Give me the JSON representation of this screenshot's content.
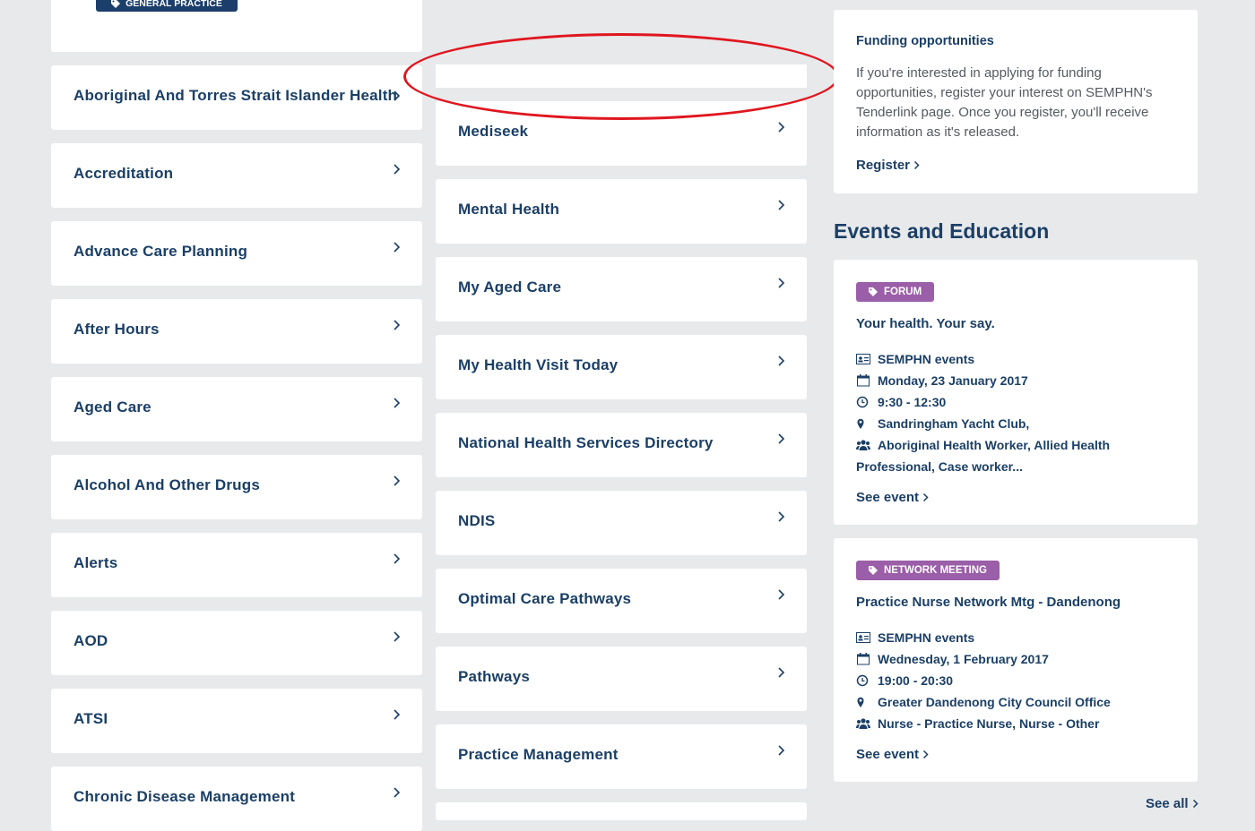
{
  "top_card": {
    "tag": "General Practice"
  },
  "col1_links": [
    "Aboriginal And Torres Strait Islander Health",
    "Accreditation",
    "Advance Care Planning",
    "After Hours",
    "Aged Care",
    "Alcohol And Other Drugs",
    "Alerts",
    "AOD",
    "ATSI",
    "Chronic Disease Management"
  ],
  "col2_links": [
    "Mediseek",
    "Mental Health",
    "My Aged Care",
    "My Health Visit Today",
    "National Health Services Directory",
    "NDIS",
    "Optimal Care Pathways",
    "Pathways",
    "Practice Management"
  ],
  "funding": {
    "title": "Funding opportunities",
    "body": "If you're interested in applying for funding opportunities, register your interest on SEMPHN's Tenderlink page. Once you register, you'll receive information as it's released.",
    "link": "Register"
  },
  "events_section": {
    "title": "Events and Education",
    "see_all": "See all"
  },
  "events": [
    {
      "tag": "Forum",
      "title": "Your health. Your say.",
      "organiser": "SEMPHN events",
      "date": "Monday, 23 January 2017",
      "time": "9:30 - 12:30",
      "location": "Sandringham Yacht Club,",
      "audience": "Aboriginal Health Worker, Allied Health Professional, Case worker...",
      "link": "See event"
    },
    {
      "tag": "Network meeting",
      "title": "Practice Nurse Network Mtg - Dandenong",
      "organiser": "SEMPHN events",
      "date": "Wednesday, 1 February 2017",
      "time": "19:00 - 20:30",
      "location": "Greater Dandenong City Council Office",
      "audience": "Nurse - Practice Nurse, Nurse - Other",
      "link": "See event"
    }
  ],
  "colors": {
    "navy": "#1b3f66",
    "tag_purple": "#9b5ea8",
    "annotation_red": "#e0161f",
    "background": "#e8e9ea"
  }
}
